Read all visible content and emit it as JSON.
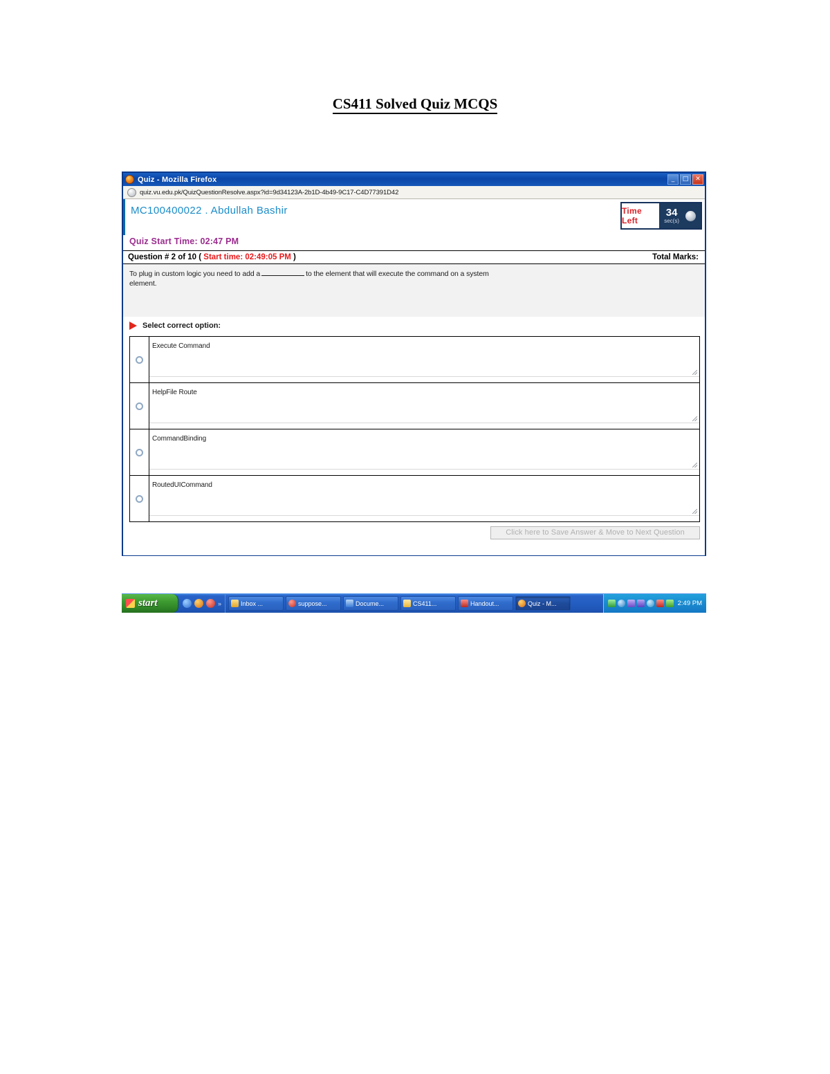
{
  "document": {
    "title": "CS411 Solved Quiz MCQS"
  },
  "browser": {
    "window_title": "Quiz - Mozilla Firefox",
    "firefox_icon": "firefox-icon",
    "minimize_label": "_",
    "maximize_label": "□",
    "close_label": "✕",
    "url": "quiz.vu.edu.pk/QuizQuestionResolve.aspx?id=9d34123A-2b1D-4b49-9C17-C4D77391D42",
    "globe_icon": "globe-icon"
  },
  "quiz": {
    "student": "MC100400022 . Abdullah Bashir",
    "timer": {
      "label": "Time Left",
      "seconds": "34",
      "unit": "sec(s)",
      "clock_icon": "clock-icon"
    },
    "start_time_line": "Quiz Start Time: 02:47 PM",
    "question_header": {
      "prefix": "Question # 2 of 10 ( ",
      "start_time": "Start time: 02:49:05 PM",
      "suffix": " )",
      "total_marks": "Total Marks:"
    },
    "question_text_part1": "To plug in custom logic you need to add a",
    "question_text_part2": "to the element that will execute the command on a system",
    "question_text_part3": "element.",
    "select_prompt": "Select correct option:",
    "arrow_icon": "red-arrow-icon",
    "options": [
      {
        "label": "Execute Command",
        "radio_icon": "radio-button-icon",
        "selected": false
      },
      {
        "label": "HelpFile Route",
        "radio_icon": "radio-button-icon",
        "selected": false
      },
      {
        "label": "CommandBinding",
        "radio_icon": "radio-button-icon",
        "selected": false
      },
      {
        "label": "RoutedUICommand",
        "radio_icon": "radio-button-icon",
        "selected": false
      }
    ],
    "submit_button": "Click here to Save Answer & Move to Next Question"
  },
  "taskbar": {
    "start_label": "start",
    "start_icon": "windows-flag-icon",
    "quick_launch": [
      {
        "icon": "internet-explorer-icon",
        "color": "#2f6fd0"
      },
      {
        "icon": "firefox-icon",
        "color": "#e07a1f"
      },
      {
        "icon": "opera-icon",
        "color": "#d6342c"
      }
    ],
    "quick_launch_more": "»",
    "items": [
      {
        "label": "Inbox ...",
        "icon": "mail-icon",
        "color": "#e8b23a",
        "active": false
      },
      {
        "label": "suppose...",
        "icon": "opera-icon",
        "color": "#d6342c",
        "active": false
      },
      {
        "label": "Docume...",
        "icon": "word-doc-icon",
        "color": "#3a7bd5",
        "active": false
      },
      {
        "label": "CS411...",
        "icon": "folder-icon",
        "color": "#f0c24a",
        "active": false
      },
      {
        "label": "Handout...",
        "icon": "pdf-icon",
        "color": "#c8342c",
        "active": false
      },
      {
        "label": "Quiz - M...",
        "icon": "firefox-icon",
        "color": "#e07a1f",
        "active": true
      }
    ],
    "tray_icons": [
      {
        "icon": "network-icon",
        "color": "#3fb54a"
      },
      {
        "icon": "volume-icon",
        "color": "#4aa3e0"
      },
      {
        "icon": "shield-icon",
        "color": "#7a5ad6"
      },
      {
        "icon": "messenger-icon",
        "color": "#6b4fd0"
      },
      {
        "icon": "update-icon",
        "color": "#3fa0d8"
      },
      {
        "icon": "antivirus-icon",
        "color": "#d6342c"
      },
      {
        "icon": "battery-icon",
        "color": "#57c04a"
      }
    ],
    "clock": "2:49 PM"
  }
}
